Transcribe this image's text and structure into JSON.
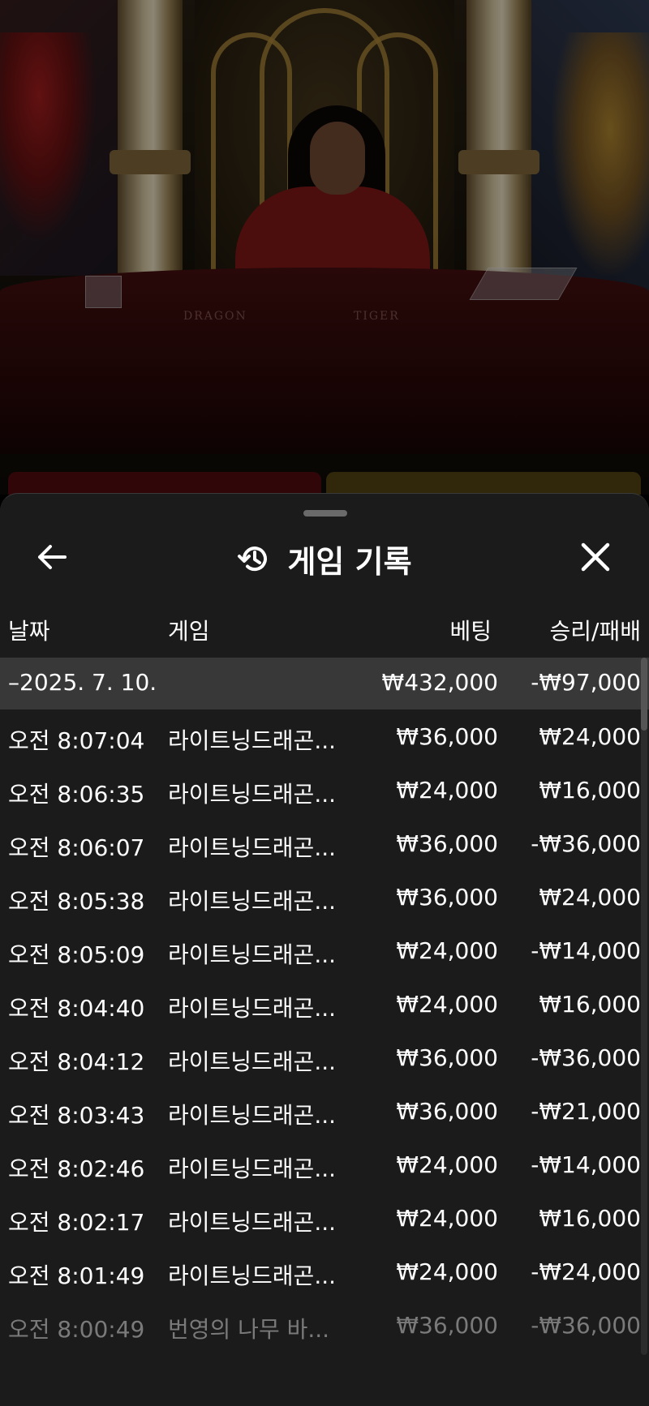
{
  "sheet": {
    "title": "게임 기록",
    "icons": {
      "back": "arrow-left-icon",
      "history": "history-icon",
      "close": "close-icon"
    }
  },
  "video": {
    "table_labels": [
      "DRAGON",
      "TIGER"
    ]
  },
  "columns": {
    "date": "날짜",
    "game": "게임",
    "bet": "베팅",
    "result": "승리/패배"
  },
  "date_group": {
    "date": "–2025. 7. 10.",
    "bet_total": "₩432,000",
    "result_total": "-₩97,000"
  },
  "rows": [
    {
      "time": "오전 8:07:04",
      "game": "라이트닝드래곤...",
      "bet": "₩36,000",
      "result": "₩24,000"
    },
    {
      "time": "오전 8:06:35",
      "game": "라이트닝드래곤...",
      "bet": "₩24,000",
      "result": "₩16,000"
    },
    {
      "time": "오전 8:06:07",
      "game": "라이트닝드래곤...",
      "bet": "₩36,000",
      "result": "-₩36,000"
    },
    {
      "time": "오전 8:05:38",
      "game": "라이트닝드래곤...",
      "bet": "₩36,000",
      "result": "₩24,000"
    },
    {
      "time": "오전 8:05:09",
      "game": "라이트닝드래곤...",
      "bet": "₩24,000",
      "result": "-₩14,000"
    },
    {
      "time": "오전 8:04:40",
      "game": "라이트닝드래곤...",
      "bet": "₩24,000",
      "result": "₩16,000"
    },
    {
      "time": "오전 8:04:12",
      "game": "라이트닝드래곤...",
      "bet": "₩36,000",
      "result": "-₩36,000"
    },
    {
      "time": "오전 8:03:43",
      "game": "라이트닝드래곤...",
      "bet": "₩36,000",
      "result": "-₩21,000"
    },
    {
      "time": "오전 8:02:46",
      "game": "라이트닝드래곤...",
      "bet": "₩24,000",
      "result": "-₩14,000"
    },
    {
      "time": "오전 8:02:17",
      "game": "라이트닝드래곤...",
      "bet": "₩24,000",
      "result": "₩16,000"
    },
    {
      "time": "오전 8:01:49",
      "game": "라이트닝드래곤...",
      "bet": "₩24,000",
      "result": "-₩24,000"
    },
    {
      "time": "오전 8:00:49",
      "game": "번영의 나무 바...",
      "bet": "₩36,000",
      "result": "-₩36,000"
    }
  ],
  "colors": {
    "sheet_bg": "#1b1b1b",
    "date_row_bg": "#383838",
    "text": "#ffffff",
    "faded_text": "#7a7a7a"
  }
}
